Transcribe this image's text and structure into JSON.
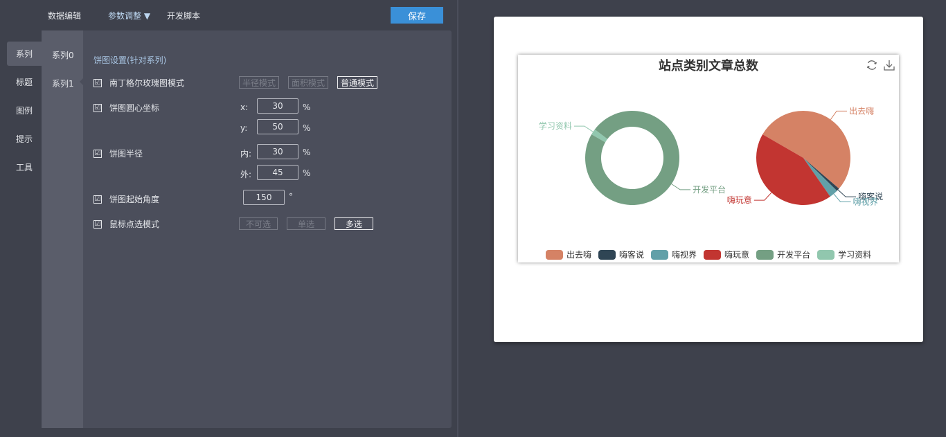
{
  "nav": {
    "data_edit": "数据编辑",
    "params": "参数调整 ▼",
    "dev_script": "开发脚本",
    "save": "保存"
  },
  "vtabs": [
    "系列",
    "标题",
    "图例",
    "提示",
    "工具"
  ],
  "subtabs": [
    "系列0",
    "系列1"
  ],
  "section_title": "饼图设置(针对系列)",
  "rows": {
    "rose": {
      "label": "南丁格尔玫瑰图模式",
      "checked": "☑",
      "modes": [
        "半径模式",
        "面积模式",
        "普通模式"
      ]
    },
    "center": {
      "label": "饼图圆心坐标",
      "checked": "☑",
      "x_label": "x:",
      "x_value": "30",
      "y_label": "y:",
      "y_value": "50",
      "unit": "%"
    },
    "radius": {
      "label": "饼图半径",
      "checked": "☑",
      "inner_label": "内:",
      "inner_value": "30",
      "outer_label": "外:",
      "outer_value": "45",
      "unit": "%"
    },
    "start_angle": {
      "label": "饼图起始角度",
      "checked": "☑",
      "value": "150",
      "unit": "°"
    },
    "select_mode": {
      "label": "鼠标点选模式",
      "checked": "☑",
      "modes": [
        "不可选",
        "单选",
        "多选"
      ]
    }
  },
  "chart_data": {
    "type": "pie",
    "title": "站点类别文章总数",
    "series": [
      {
        "name": "系列0",
        "style": "donut",
        "values": [
          {
            "name": "学习资料",
            "value": 2
          },
          {
            "name": "开发平台",
            "value": 98
          }
        ]
      },
      {
        "name": "系列1",
        "style": "pie",
        "values": [
          {
            "name": "出去嗨",
            "value": 53
          },
          {
            "name": "嗨客说",
            "value": 1
          },
          {
            "name": "嗨视界",
            "value": 3
          },
          {
            "name": "嗨玩意",
            "value": 43
          }
        ]
      }
    ],
    "legend": [
      "出去嗨",
      "嗨客说",
      "嗨视界",
      "嗨玩意",
      "开发平台",
      "学习资料"
    ],
    "legend_position": "bottom"
  },
  "colors": {
    "出去嗨": "#d58265",
    "嗨客说": "#2f4554",
    "嗨视界": "#61a0a8",
    "嗨玩意": "#c23531",
    "开发平台": "#749f83",
    "学习资料": "#91c7ae"
  },
  "icons": {
    "refresh": "refresh-icon",
    "download": "download-icon"
  }
}
